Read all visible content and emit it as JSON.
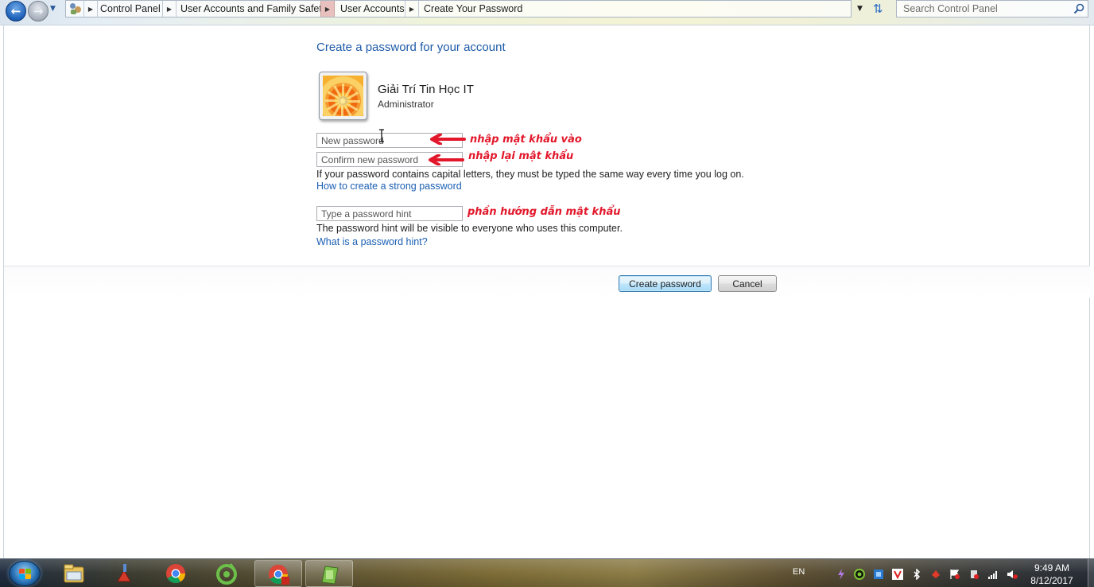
{
  "address_bar": {
    "breadcrumbs": [
      "Control Panel",
      "User Accounts and Family Safety",
      "User Accounts",
      "Create Your Password"
    ],
    "search_placeholder": "Search Control Panel"
  },
  "page": {
    "title": "Create a password for your account",
    "user_name": "Giải Trí Tin Học IT",
    "user_role": "Administrator",
    "new_password_placeholder": "New password",
    "confirm_password_placeholder": "Confirm new password",
    "capital_letters_note": "If your password contains capital letters, they must be typed the same way every time you log on.",
    "strong_password_link": "How to create a strong password",
    "hint_placeholder": "Type a password hint",
    "hint_note": "The password hint will be visible to everyone who uses this computer.",
    "hint_link": "What is a password hint?",
    "create_button": "Create password",
    "cancel_button": "Cancel"
  },
  "annotations": {
    "new_password": "nhập mật khẩu vào",
    "confirm_password": "nhập lại mật khẩu",
    "hint": "phần hướng dẫn mật khẩu",
    "color": "#e2172b"
  },
  "taskbar": {
    "apps": [
      "windows-explorer",
      "ccleaner",
      "chrome",
      "coc-coc",
      "chrome-alt",
      "control-panel"
    ],
    "language": "EN",
    "time": "9:49 AM",
    "date": "8/12/2017"
  }
}
